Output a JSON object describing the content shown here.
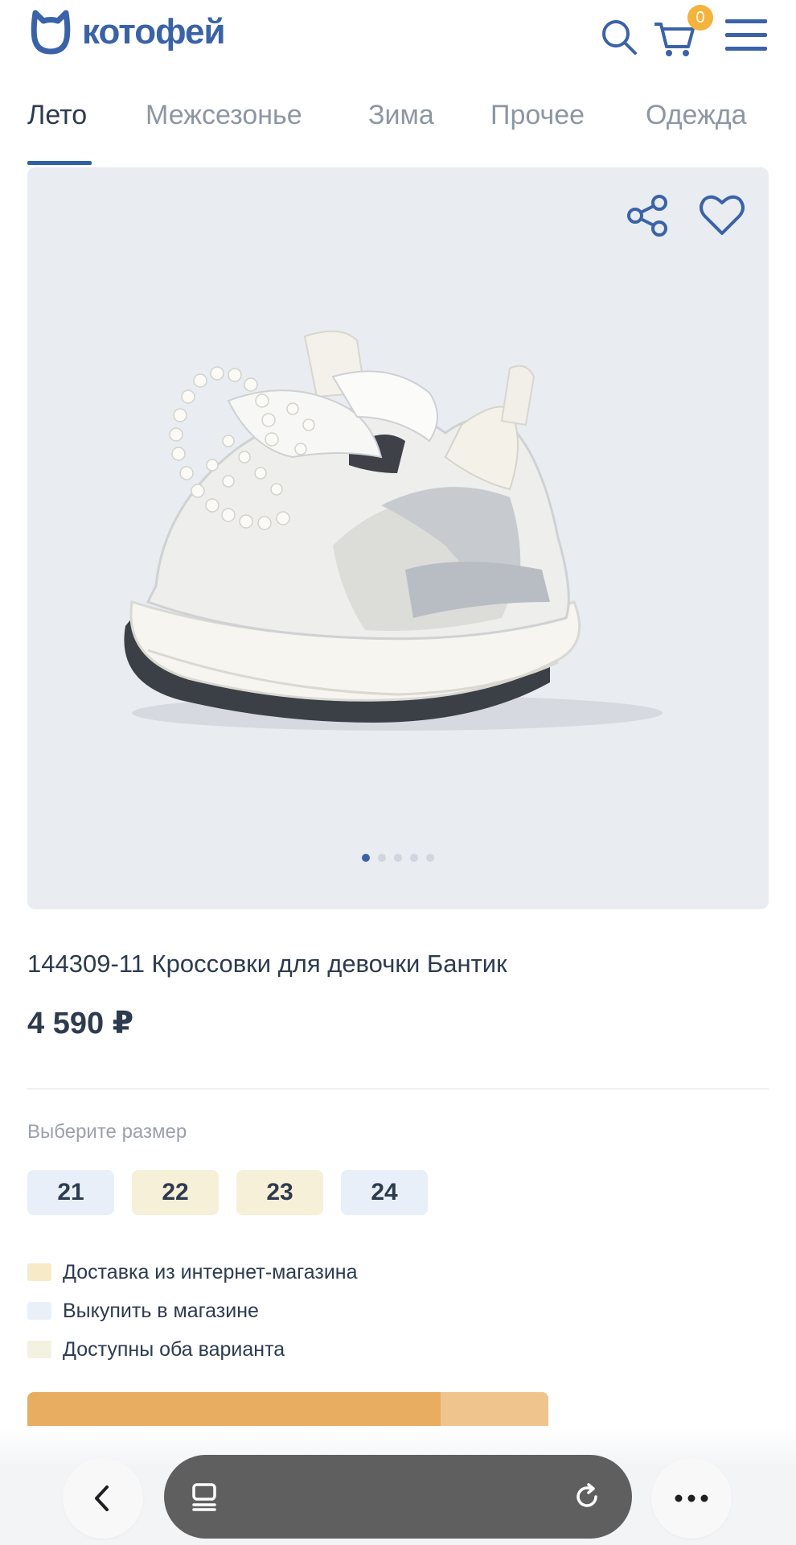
{
  "header": {
    "logo_text": "котофей",
    "cart_count": "0"
  },
  "tabs": [
    {
      "label": "Лето",
      "active": true
    },
    {
      "label": "Межсезонье",
      "active": false
    },
    {
      "label": "Зима",
      "active": false
    },
    {
      "label": "Прочее",
      "active": false
    },
    {
      "label": "Одежда",
      "active": false
    }
  ],
  "gallery": {
    "total_slides": 5,
    "current_slide": 1
  },
  "product": {
    "title": "144309-11 Кроссовки для девочки Бантик",
    "price": "4 590 ₽"
  },
  "sizes": {
    "label": "Выберите размер",
    "options": [
      {
        "value": "21",
        "availability": "store",
        "color": "#e8eff8"
      },
      {
        "value": "22",
        "availability": "both",
        "color": "#f7f0d8"
      },
      {
        "value": "23",
        "availability": "both",
        "color": "#f7f0d8"
      },
      {
        "value": "24",
        "availability": "store",
        "color": "#e8eff8"
      }
    ]
  },
  "legend": [
    {
      "text": "Доставка из интернет-магазина",
      "color": "#f6ebc6"
    },
    {
      "text": "Выкупить в магазине",
      "color": "#e9f0f8"
    },
    {
      "text": "Доступны оба варианта",
      "color": "#f3f1e1"
    }
  ],
  "colors": {
    "brand": "#3a63a7",
    "accent": "#e8ad60",
    "badge": "#f3b33d"
  }
}
